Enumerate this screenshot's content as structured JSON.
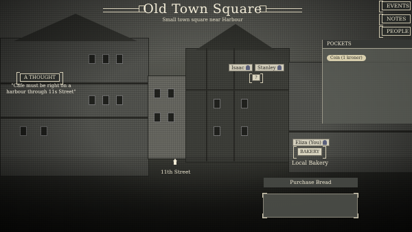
{
  "header": {
    "title": "Old Town Square",
    "subtitle": "Small town square near Harbour"
  },
  "menu": {
    "events": "EVENTS",
    "notes": "NOTES",
    "people": "PEOPLE"
  },
  "pockets": {
    "header": "POCKETS",
    "items": [
      "Coin (1 kroner)"
    ]
  },
  "thought": {
    "label": "A THOUGHT",
    "text": "\"Cafe must be right on a harbour through 11s Street\""
  },
  "characters": {
    "isaac": "Isaac",
    "stanley": "Stanley",
    "eliza": "Eliza (You)",
    "unknown_marker": "?"
  },
  "locations": {
    "street": "11th Street",
    "bakery_badge": "BAKERY",
    "bakery": "Local Bakery"
  },
  "actions": {
    "purchase": "Purchase Bread",
    "dialog_text": ""
  }
}
